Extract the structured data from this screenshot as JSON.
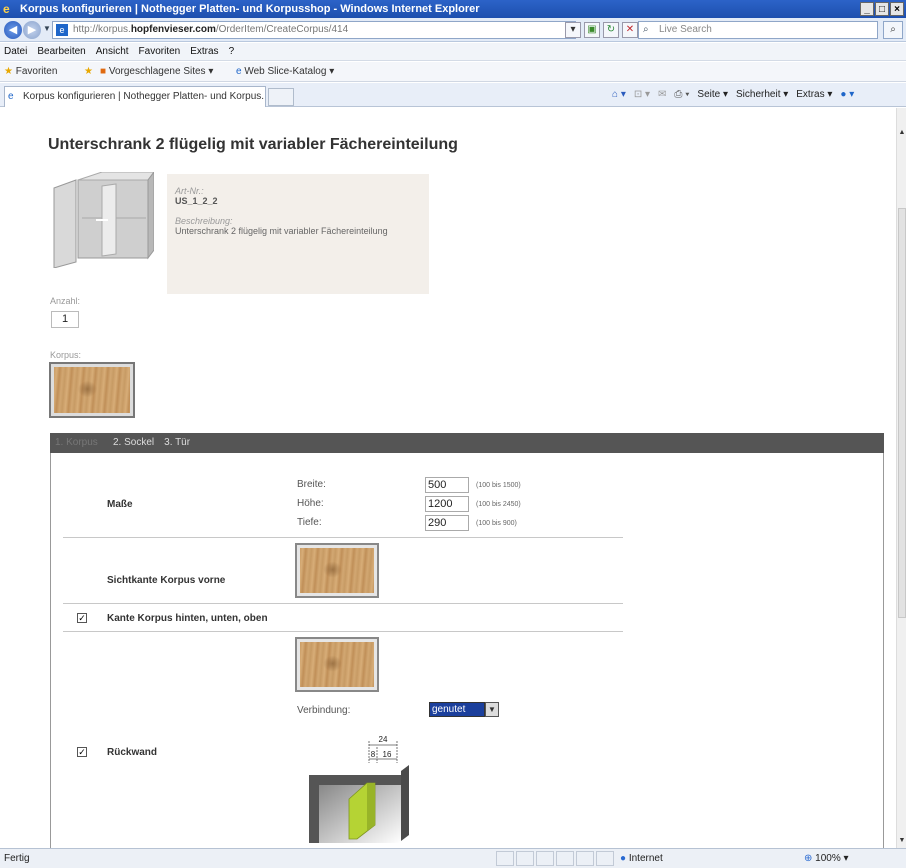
{
  "window": {
    "title": "Korpus konfigurieren | Nothegger Platten- und Korpusshop - Windows Internet Explorer",
    "controls": [
      "_",
      "□",
      "×"
    ]
  },
  "address": {
    "url_prefix": "http://korpus.",
    "url_domain": "hopfenvieser.com",
    "url_path": "/OrderItem/CreateCorpus/414",
    "search_placeholder": "Live Search"
  },
  "menu": [
    "Datei",
    "Bearbeiten",
    "Ansicht",
    "Favoriten",
    "Extras",
    "?"
  ],
  "favorites": {
    "label": "Favoriten",
    "items": [
      "Vorgeschlagene Sites ▾",
      "Web Slice-Katalog ▾"
    ]
  },
  "tab": {
    "title": "Korpus konfigurieren | Nothegger Platten- und Korpus..."
  },
  "commandbar": [
    "Seite ▾",
    "Sicherheit ▾",
    "Extras ▾"
  ],
  "page": {
    "title": "Unterschrank 2 flügelig mit variabler Fächereinteilung",
    "art_nr_label": "Art-Nr.:",
    "art_nr": "US_1_2_2",
    "beschreibung_label": "Beschreibung:",
    "beschreibung": "Unterschrank 2 flügelig mit variabler Fächereinteilung",
    "anzahl_label": "Anzahl:",
    "anzahl": "1",
    "korpus_label": "Korpus:"
  },
  "steps": [
    "1. Korpus",
    "2. Sockel",
    "3. Tür"
  ],
  "config": {
    "masse_label": "Maße",
    "breite_label": "Breite:",
    "breite": "500",
    "breite_range": "(100 bis 1500)",
    "hoehe_label": "Höhe:",
    "hoehe": "1200",
    "hoehe_range": "(100 bis 2450)",
    "tiefe_label": "Tiefe:",
    "tiefe": "290",
    "tiefe_range": "(100 bis 900)",
    "sichtkante_label": "Sichtkante Korpus vorne",
    "kante_label": "Kante Korpus hinten, unten, oben",
    "kante_checked": true,
    "verbindung_label": "Verbindung:",
    "verbindung_value": "genutet",
    "rueckwand_label": "Rückwand",
    "rueckwand_checked": true,
    "dim_top": "24",
    "dim_left": "8",
    "dim_right": "16"
  },
  "status": {
    "text": "Fertig",
    "zone": "Internet",
    "zoom": "100%"
  },
  "colors": {
    "accent_green": "#b5d334",
    "tab_bar": "#555555",
    "selection": "#1b3f9c"
  }
}
